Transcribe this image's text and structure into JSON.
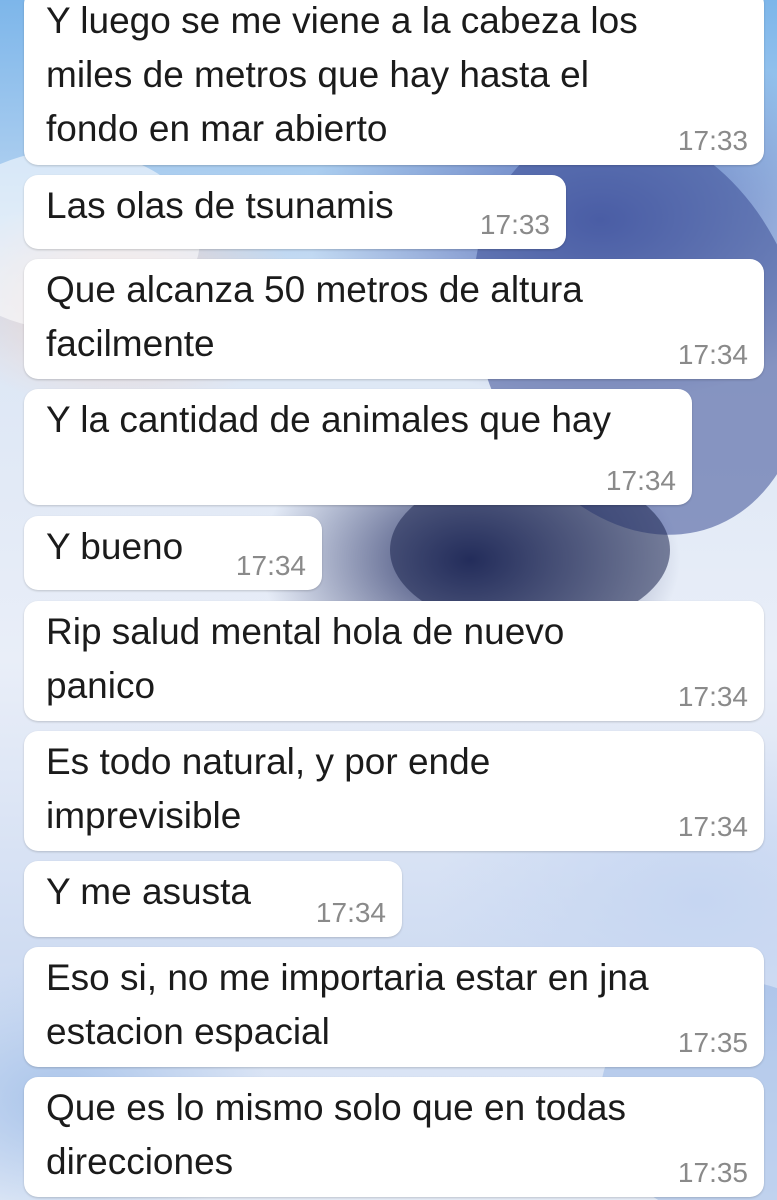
{
  "messages": [
    {
      "text": "Y luego se me viene a la cabeza los\nmiles de metros que hay hasta el\nfondo en mar abierto",
      "time": "17:33"
    },
    {
      "text": "Las olas de tsunamis",
      "time": "17:33"
    },
    {
      "text": "Que alcanza 50 metros de altura\nfacilmente",
      "time": "17:34"
    },
    {
      "text": "Y la cantidad de animales que hay",
      "time": "17:34"
    },
    {
      "text": "Y bueno",
      "time": "17:34"
    },
    {
      "text": "Rip salud mental hola de nuevo\npanico",
      "time": "17:34"
    },
    {
      "text": "Es todo natural, y por ende\nimprevisible",
      "time": "17:34"
    },
    {
      "text": "Y me asusta",
      "time": "17:34"
    },
    {
      "text": "Eso si, no me importaria estar en jna\nestacion espacial",
      "time": "17:35"
    },
    {
      "text": "Que es lo mismo solo que en todas\ndirecciones",
      "time": "17:35"
    }
  ]
}
